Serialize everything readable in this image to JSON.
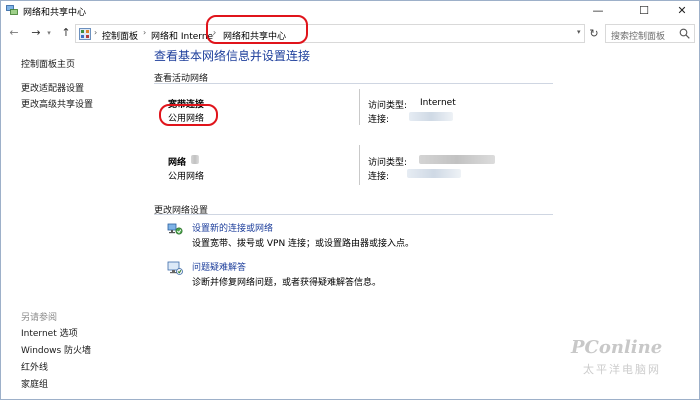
{
  "window": {
    "title": "网络和共享中心",
    "controls": {
      "minimize": "—",
      "maximize": "☐",
      "close": "✕"
    }
  },
  "address_bar": {
    "breadcrumbs": [
      "控制面板",
      "网络和 Internet",
      "网络和共享中心"
    ],
    "search_placeholder": "搜索控制面板"
  },
  "sidebar": {
    "top_links": [
      "控制面板主页",
      "更改适配器设置",
      "更改高级共享设置"
    ],
    "see_also_header": "另请参阅",
    "see_also_links": [
      "Internet 选项",
      "Windows 防火墙",
      "红外线",
      "家庭组"
    ]
  },
  "main": {
    "title": "查看基本网络信息并设置连接",
    "active_networks_label": "查看活动网络",
    "networks": [
      {
        "name": "宽带连接",
        "type": "公用网络",
        "access_label": "访问类型:",
        "access_value": "Internet",
        "conn_label": "连接:"
      },
      {
        "name": "网络",
        "type": "公用网络",
        "access_label": "访问类型:",
        "access_value": "",
        "conn_label": "连接:"
      }
    ],
    "change_settings_label": "更改网络设置",
    "tasks": [
      {
        "icon": "network-setup-icon",
        "link": "设置新的连接或网络",
        "desc": "设置宽带、拨号或 VPN 连接；或设置路由器或接入点。"
      },
      {
        "icon": "troubleshoot-icon",
        "link": "问题疑难解答",
        "desc": "诊断并修复网络问题，或者获得疑难解答信息。"
      }
    ]
  },
  "watermark": {
    "brand": "PConline",
    "sub": "太平洋电脑网"
  },
  "colors": {
    "link_blue": "#1e3f9c",
    "annotation_red": "#e0141b"
  }
}
